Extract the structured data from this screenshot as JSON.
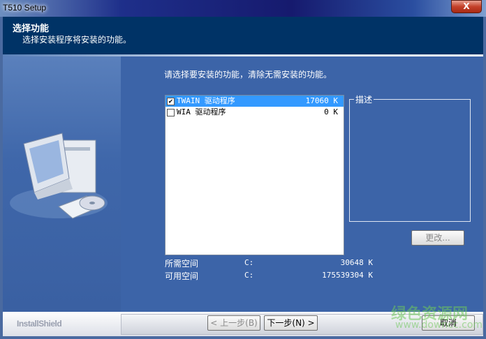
{
  "window": {
    "title": "T510 Setup",
    "close_label": "X"
  },
  "header": {
    "title": "选择功能",
    "subtitle": "选择安装程序将安装的功能。"
  },
  "main": {
    "instruction": "请选择要安装的功能，清除无需安装的功能。",
    "features": [
      {
        "label": "TWAIN 驱动程序",
        "size": "17060 K",
        "checked": true,
        "selected": true
      },
      {
        "label": "WIA 驱动程序",
        "size": "0 K",
        "checked": false,
        "selected": false
      }
    ],
    "description_label": "描述",
    "change_button": "更改...",
    "space": [
      {
        "label": "所需空间",
        "drive": "C:",
        "value": "30648 K"
      },
      {
        "label": "可用空间",
        "drive": "C:",
        "value": "175539304 K"
      }
    ]
  },
  "footer": {
    "brand": "InstallShield",
    "back": "< 上一步(B)",
    "next": "下一步(N) >",
    "cancel": "取消"
  },
  "watermark": {
    "text": "绿色资源网",
    "url": "www.downcc.com"
  }
}
